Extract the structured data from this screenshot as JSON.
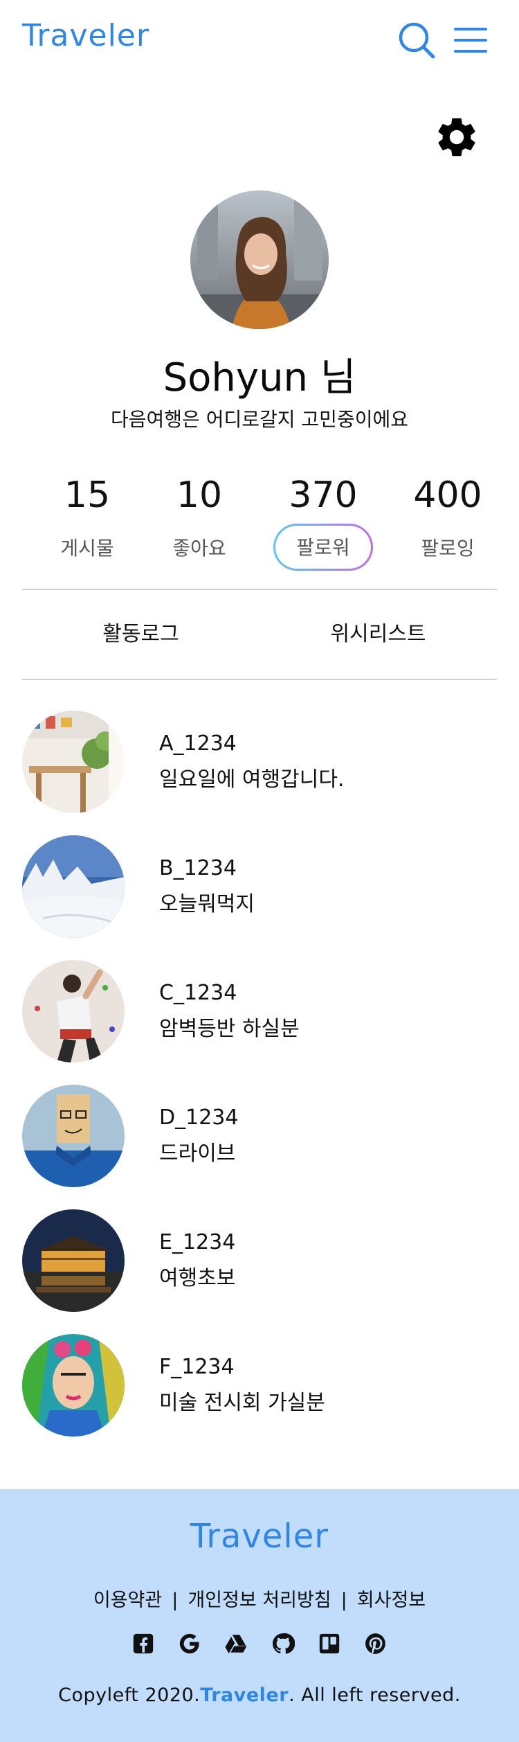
{
  "app": {
    "logo": "Traveler"
  },
  "header": {
    "search_icon": "search-icon",
    "menu_icon": "hamburger-menu-icon"
  },
  "settings": {
    "icon": "gear-icon"
  },
  "profile": {
    "name": "Sohyun 님",
    "bio": "다음여행은 어디로갈지 고민중이에요"
  },
  "stats": [
    {
      "count": "15",
      "label": "게시물"
    },
    {
      "count": "10",
      "label": "좋아요"
    },
    {
      "count": "370",
      "label": "팔로워",
      "active": true
    },
    {
      "count": "400",
      "label": "팔로잉"
    }
  ],
  "tabs": [
    {
      "label": "활동로그"
    },
    {
      "label": "위시리스트"
    }
  ],
  "list": [
    {
      "user": "A_1234",
      "text": "일요일에 여행갑니다."
    },
    {
      "user": "B_1234",
      "text": "오늘뭐먹지"
    },
    {
      "user": "C_1234",
      "text": "암벽등반 하실분"
    },
    {
      "user": "D_1234",
      "text": "드라이브"
    },
    {
      "user": "E_1234",
      "text": "여행초보"
    },
    {
      "user": "F_1234",
      "text": "미술 전시회 가실분"
    }
  ],
  "footer": {
    "logo": "Traveler",
    "links": [
      "이용약관",
      "개인정보 처리방침",
      "회사정보"
    ],
    "socials": [
      "facebook-icon",
      "google-icon",
      "google-drive-icon",
      "github-icon",
      "trello-icon",
      "pinterest-icon"
    ],
    "copyright_prefix": "Copyleft 2020.",
    "copyright_brand": "Traveler",
    "copyright_suffix": ". All left reserved."
  },
  "colors": {
    "brand": "#2f86e6",
    "footer_bg": "#c2ddfb",
    "pill_start": "#5ec5f2",
    "pill_end": "#c06be6"
  }
}
